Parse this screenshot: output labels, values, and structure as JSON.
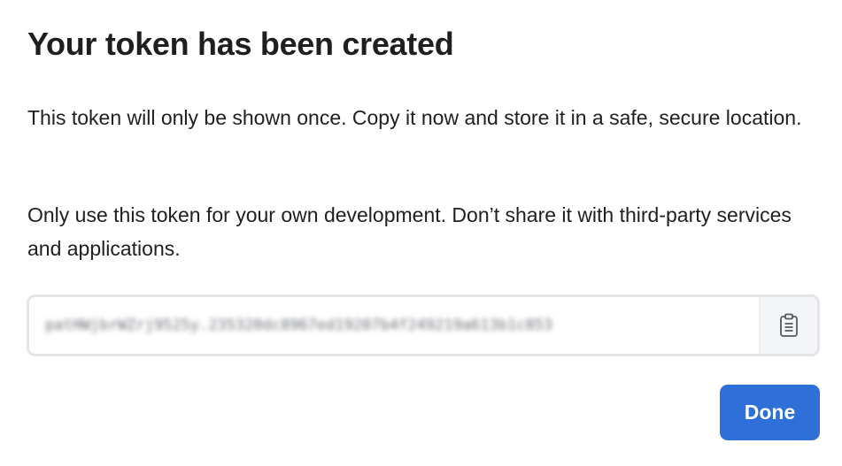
{
  "dialog": {
    "title": "Your token has been created",
    "paragraph_1": "This token will only be shown once. Copy it now and store it in a safe, secure location.",
    "paragraph_2": "Only use this token for your own development. Don’t share it with third-party services and applications.",
    "token_value": "patHWjbrWZrj9525y.235320dc8967ed19207b4f249219a613b1c853",
    "copy_icon": "clipboard-icon",
    "done_label": "Done"
  },
  "colors": {
    "accent": "#2f6fd8",
    "border": "#e3e5e8",
    "text": "#1d1f21"
  }
}
